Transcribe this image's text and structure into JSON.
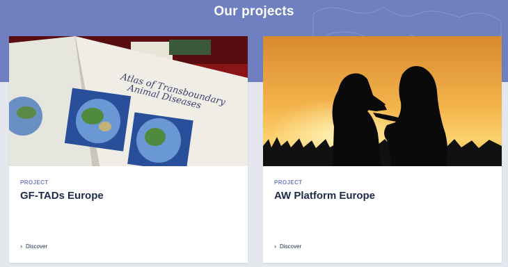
{
  "section": {
    "title": "Our projects"
  },
  "cards": [
    {
      "tag": "PROJECT",
      "title": "GF-TADs Europe",
      "link": "Discover",
      "image": "atlas-of-transboundary-animal-diseases-book"
    },
    {
      "tag": "PROJECT",
      "title": "AW Platform Europe",
      "link": "Discover",
      "image": "dog-and-woman-silhouette-sunset"
    }
  ],
  "icons": {
    "chevron": "chevron-right-icon"
  },
  "colors": {
    "band": "#6f7fc0",
    "title": "#1d2a4a",
    "background": "#e4e8ee"
  }
}
